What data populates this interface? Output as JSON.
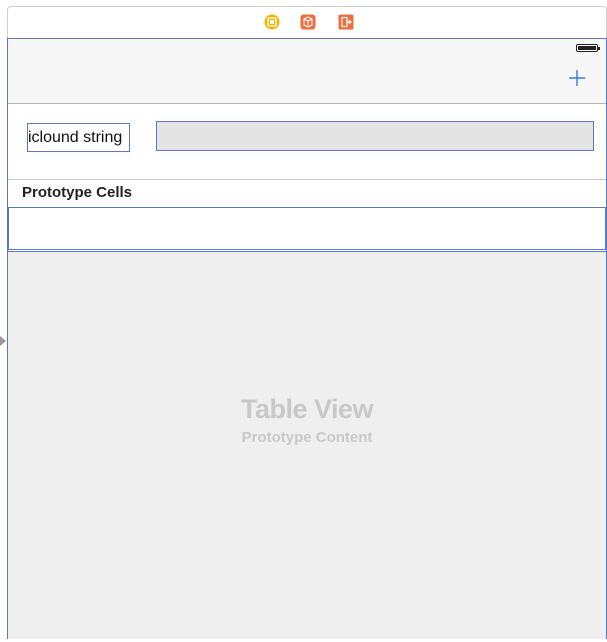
{
  "scene_dock": {
    "icons": [
      {
        "name": "view-controller-icon",
        "color": "#f5b400"
      },
      {
        "name": "first-responder-icon",
        "color": "#ef6d3a"
      },
      {
        "name": "exit-icon",
        "color": "#ef6d3a"
      }
    ]
  },
  "nav_bar": {
    "add_icon": "plus-icon",
    "accent_color": "#3478f6"
  },
  "header": {
    "label_text": "iclound string",
    "text_field_value": ""
  },
  "table": {
    "section_title": "Prototype Cells",
    "placeholder_title": "Table View",
    "placeholder_subtitle": "Prototype Content"
  },
  "colors": {
    "selection_border": "#5b79c7",
    "placeholder_bg": "#efefef",
    "placeholder_text": "#c8c8c8"
  }
}
